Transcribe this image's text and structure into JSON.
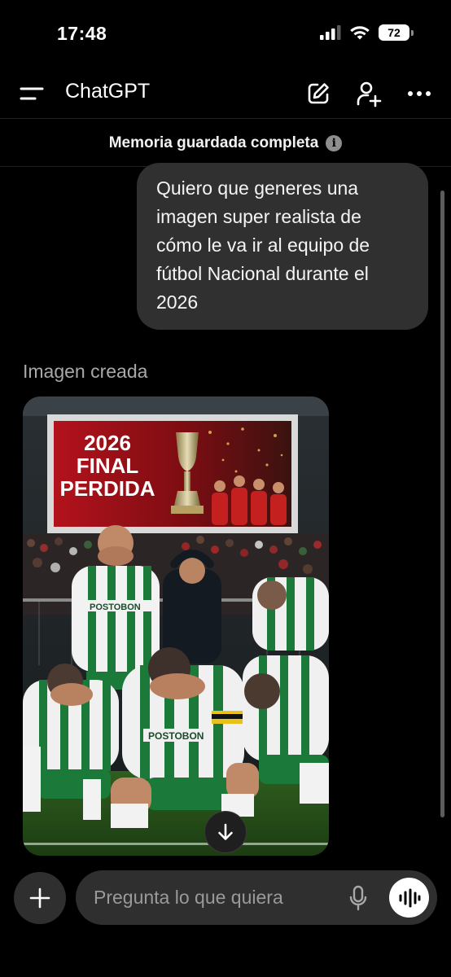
{
  "status_bar": {
    "time": "17:48",
    "battery_level": "72",
    "signal_icon": "cellular-signal-icon",
    "wifi_icon": "wifi-icon"
  },
  "header": {
    "title": "ChatGPT",
    "menu_icon": "menu-icon",
    "new_chat_icon": "compose-icon",
    "add_person_icon": "add-person-icon",
    "more_icon": "more-options-icon"
  },
  "memory_banner": {
    "text": "Memoria guardada completa",
    "info_icon": "i"
  },
  "conversation": {
    "user_message": "Quiero que generes una imagen super realista de cómo le va ir al equipo de fútbol Nacional durante el 2026",
    "assistant_label": "Imagen creada",
    "generated_image": {
      "banner_year": "2026",
      "banner_line1": "FINAL",
      "banner_line2": "PERDIDA",
      "jersey_sponsor": "POSTOBON"
    }
  },
  "composer": {
    "placeholder": "Pregunta lo que quiera",
    "plus_icon": "plus-icon",
    "mic_icon": "microphone-icon",
    "voice_icon": "voice-mode-icon"
  },
  "colors": {
    "background": "#000000",
    "bubble": "#303030",
    "composer": "#2f2f2f",
    "muted_text": "#a8a8a8",
    "nacional_green": "#1b7a3a",
    "banner_red": "#b3121c"
  }
}
